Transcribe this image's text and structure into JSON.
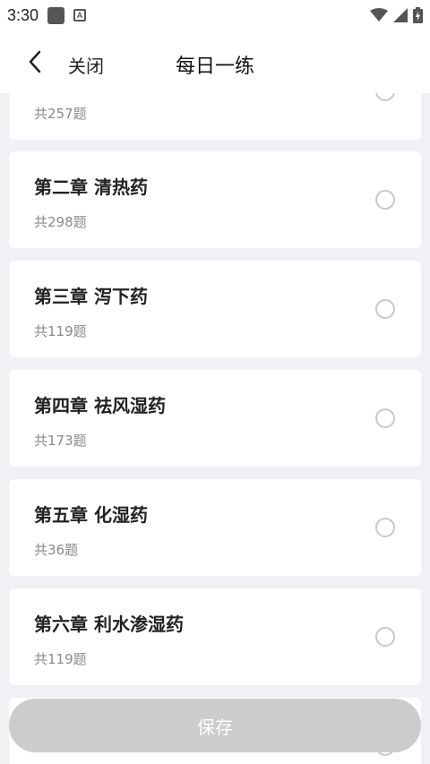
{
  "status_bar": {
    "time": "3:30",
    "icons": [
      "notification-square-icon",
      "a-app-icon",
      "wifi-icon",
      "signal-icon",
      "battery-icon"
    ]
  },
  "header": {
    "close_label": "关闭",
    "title": "每日一练"
  },
  "chapters": [
    {
      "title": "",
      "count": "共257题",
      "selected": false
    },
    {
      "title": "第二章 清热药",
      "count": "共298题",
      "selected": false
    },
    {
      "title": "第三章 泻下药",
      "count": "共119题",
      "selected": false
    },
    {
      "title": "第四章 祛风湿药",
      "count": "共173题",
      "selected": false
    },
    {
      "title": "第五章 化湿药",
      "count": "共36题",
      "selected": false
    },
    {
      "title": "第六章 利水渗湿药",
      "count": "共119题",
      "selected": false
    },
    {
      "title": "",
      "count": "",
      "selected": false
    }
  ],
  "save_label": "保存",
  "colors": {
    "background": "#f0f0f5",
    "card": "#ffffff",
    "save_button_disabled": "#cccccc",
    "radio_border": "#c8c8c8"
  }
}
